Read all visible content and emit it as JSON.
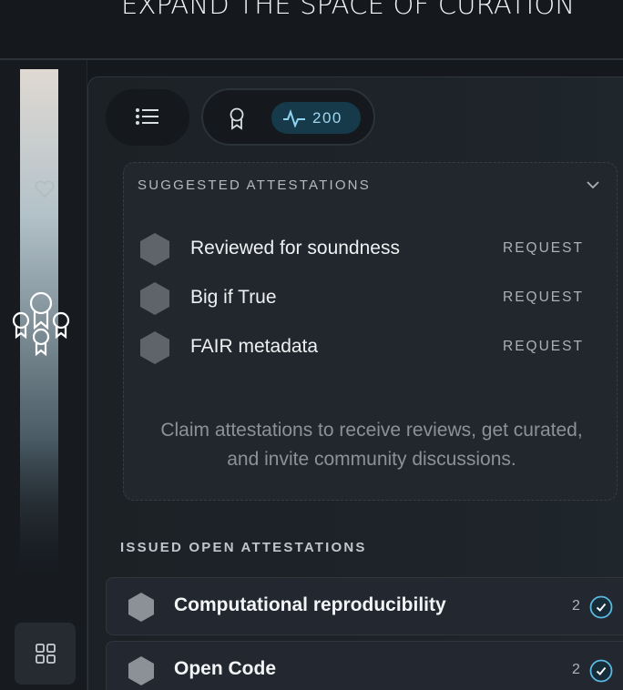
{
  "headline": "EXPAND THE SPACE OF CURATION",
  "toolbar": {
    "list_icon": "list-icon",
    "award_icon": "award-icon",
    "activity_icon": "activity-icon",
    "activity_count": "200",
    "accent_color": "#173a4b"
  },
  "rail": {
    "icons": [
      "heart-icon",
      "badges-icon",
      "compass-icon",
      "grid-icon"
    ]
  },
  "suggested": {
    "title": "SUGGESTED ATTESTATIONS",
    "items": [
      {
        "label": "Reviewed for soundness",
        "action": "REQUEST"
      },
      {
        "label": "Big if True",
        "action": "REQUEST"
      },
      {
        "label": "FAIR metadata",
        "action": "REQUEST"
      }
    ],
    "note": "Claim attestations to receive reviews, get curated, and invite community discussions."
  },
  "issued": {
    "title": "ISSUED OPEN ATTESTATIONS",
    "items": [
      {
        "label": "Computational reproducibility",
        "count": "2"
      },
      {
        "label": "Open Code",
        "count": "2"
      }
    ]
  }
}
